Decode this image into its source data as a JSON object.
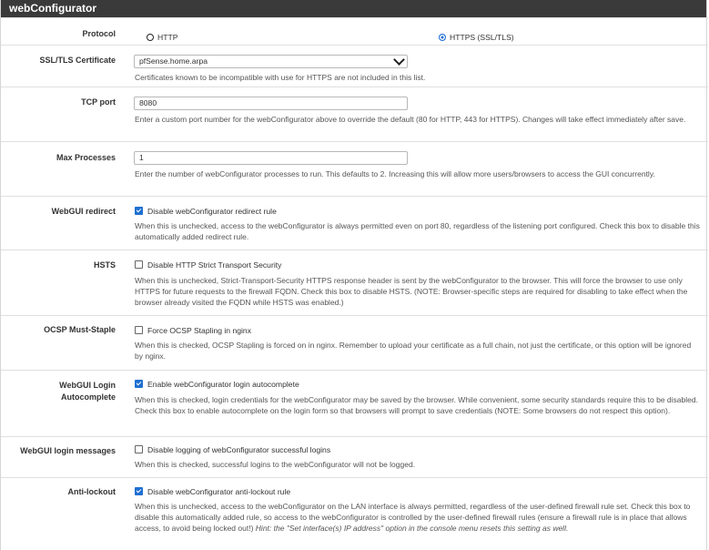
{
  "panel": {
    "title": "webConfigurator"
  },
  "protocol": {
    "label": "Protocol",
    "http": "HTTP",
    "https": "HTTPS (SSL/TLS)",
    "selected": "https"
  },
  "certificate": {
    "label": "SSL/TLS Certificate",
    "value": "pfSense.home.arpa",
    "help": "Certificates known to be incompatible with use for HTTPS are not included in this list."
  },
  "tcp_port": {
    "label": "TCP port",
    "value": "8080",
    "help": "Enter a custom port number for the webConfigurator above to override the default (80 for HTTP, 443 for HTTPS). Changes will take effect immediately after save."
  },
  "max_processes": {
    "label": "Max Processes",
    "value": "1",
    "help": "Enter the number of webConfigurator processes to run. This defaults to 2. Increasing this will allow more users/browsers to access the GUI concurrently."
  },
  "webgui_redirect": {
    "label": "WebGUI redirect",
    "checkbox": "Disable webConfigurator redirect rule",
    "checked": true,
    "help": "When this is unchecked, access to the webConfigurator is always permitted even on port 80, regardless of the listening port configured. Check this box to disable this automatically added redirect rule."
  },
  "hsts": {
    "label": "HSTS",
    "checkbox": "Disable HTTP Strict Transport Security",
    "checked": false,
    "help": "When this is unchecked, Strict-Transport-Security HTTPS response header is sent by the webConfigurator to the browser. This will force the browser to use only HTTPS for future requests to the firewall FQDN. Check this box to disable HSTS. (NOTE: Browser-specific steps are required for disabling to take effect when the browser already visited the FQDN while HSTS was enabled.)"
  },
  "ocsp": {
    "label": "OCSP Must-Staple",
    "checkbox": "Force OCSP Stapling in nginx",
    "checked": false,
    "help": "When this is checked, OCSP Stapling is forced on in nginx. Remember to upload your certificate as a full chain, not just the certificate, or this option will be ignored by nginx."
  },
  "login_autocomplete": {
    "label_line1": "WebGUI Login",
    "label_line2": "Autocomplete",
    "checkbox": "Enable webConfigurator login autocomplete",
    "checked": true,
    "help": "When this is checked, login credentials for the webConfigurator may be saved by the browser. While convenient, some security standards require this to be disabled. Check this box to enable autocomplete on the login form so that browsers will prompt to save credentials (NOTE: Some browsers do not respect this option)."
  },
  "login_messages": {
    "label": "WebGUI login messages",
    "checkbox": "Disable logging of webConfigurator successful logins",
    "checked": false,
    "help": "When this is checked, successful logins to the webConfigurator will not be logged."
  },
  "anti_lockout": {
    "label": "Anti-lockout",
    "checkbox": "Disable webConfigurator anti-lockout rule",
    "checked": true,
    "help_main": "When this is unchecked, access to the webConfigurator on the LAN interface is always permitted, regardless of the user-defined firewall rule set. Check this box to disable this automatically added rule, so access to the webConfigurator is controlled by the user-defined firewall rules (ensure a firewall rule is in place that allows access, to avoid being locked out!)",
    "help_hint": "Hint: the \"Set interface(s) IP address\" option in the console menu resets this setting as well."
  }
}
